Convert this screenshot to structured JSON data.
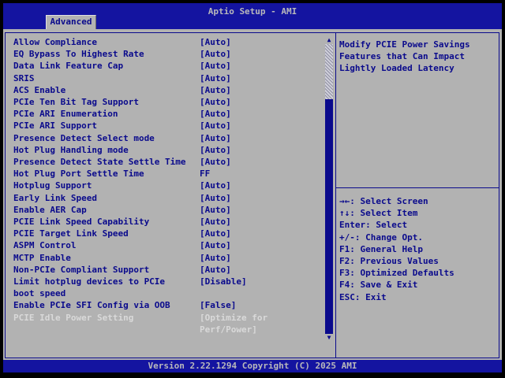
{
  "header": {
    "title": "Aptio Setup - AMI",
    "tab": "Advanced"
  },
  "settings": {
    "items": [
      {
        "label": "Allow Compliance",
        "value": "[Auto]",
        "selected": false
      },
      {
        "label": "EQ Bypass To Highest Rate",
        "value": "[Auto]",
        "selected": false
      },
      {
        "label": "Data Link Feature Cap",
        "value": "[Auto]",
        "selected": false
      },
      {
        "label": "SRIS",
        "value": "[Auto]",
        "selected": false
      },
      {
        "label": "ACS Enable",
        "value": "[Auto]",
        "selected": false
      },
      {
        "label": "PCIe Ten Bit Tag Support",
        "value": "[Auto]",
        "selected": false
      },
      {
        "label": "PCIe ARI Enumeration",
        "value": "[Auto]",
        "selected": false
      },
      {
        "label": "PCIe ARI Support",
        "value": "[Auto]",
        "selected": false
      },
      {
        "label": "Presence Detect Select mode",
        "value": "[Auto]",
        "selected": false
      },
      {
        "label": "Hot Plug Handling mode",
        "value": "[Auto]",
        "selected": false
      },
      {
        "label": "Presence Detect State Settle Time",
        "value": "[Auto]",
        "selected": false
      },
      {
        "label": "Hot Plug Port Settle Time",
        "value": "FF",
        "selected": false
      },
      {
        "label": "Hotplug Support",
        "value": "[Auto]",
        "selected": false
      },
      {
        "label": "Early Link Speed",
        "value": "[Auto]",
        "selected": false
      },
      {
        "label": "Enable AER Cap",
        "value": "[Auto]",
        "selected": false
      },
      {
        "label": "PCIE Link Speed Capability",
        "value": "[Auto]",
        "selected": false
      },
      {
        "label": "PCIE Target Link Speed",
        "value": "[Auto]",
        "selected": false
      },
      {
        "label": "ASPM Control",
        "value": "[Auto]",
        "selected": false
      },
      {
        "label": "MCTP Enable",
        "value": "[Auto]",
        "selected": false
      },
      {
        "label": "Non-PCIe Compliant Support",
        "value": "[Auto]",
        "selected": false
      },
      {
        "label": "Limit hotplug devices to PCIe\nboot speed",
        "value": "[Disable]",
        "selected": false
      },
      {
        "label": "Enable PCIe SFI Config via OOB",
        "value": "[False]",
        "selected": false
      },
      {
        "label": "PCIE Idle Power Setting",
        "value": "[Optimize for\nPerf/Power]",
        "selected": true
      }
    ]
  },
  "help": {
    "text": "Modify PCIE Power Savings\nFeatures that Can Impact\nLightly Loaded Latency"
  },
  "keys": [
    "→←: Select Screen",
    "↑↓: Select Item",
    "Enter: Select",
    "+/-: Change Opt.",
    "F1: General Help",
    "F2: Previous Values",
    "F3: Optimized Defaults",
    "F4: Save & Exit",
    "ESC: Exit"
  ],
  "footer": {
    "text": "Version 2.22.1294 Copyright (C) 2025 AMI"
  },
  "icons": {
    "scroll_up": "▲",
    "scroll_down": "▼"
  },
  "colors": {
    "blue": "#1414a0",
    "navy": "#0a0a8c",
    "gray": "#b2b2b2",
    "selected": "#d9d9d9",
    "lightgray": "#b9b9bb"
  }
}
